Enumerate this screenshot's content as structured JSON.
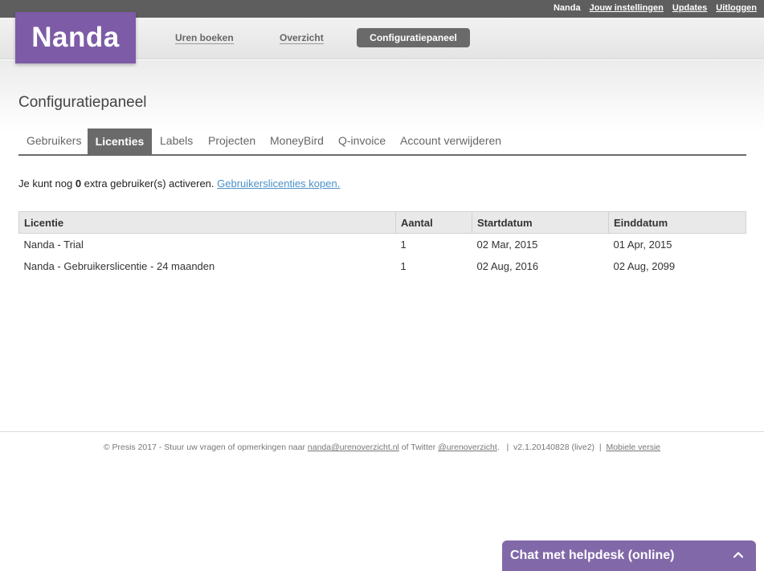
{
  "topbar": {
    "username": "Nanda",
    "settings_link": "Jouw instellingen",
    "updates_link": "Updates",
    "logout_link": "Uitloggen"
  },
  "header": {
    "logo": "Nanda",
    "nav": {
      "book_hours": "Uren boeken",
      "overview": "Overzicht",
      "config_panel": "Configuratiepaneel"
    }
  },
  "page": {
    "title": "Configuratiepaneel",
    "tabs": [
      "Gebruikers",
      "Licenties",
      "Labels",
      "Projecten",
      "MoneyBird",
      "Q-invoice",
      "Account verwijderen"
    ],
    "active_tab": "Licenties",
    "info": {
      "prefix": "Je kunt nog ",
      "count": "0",
      "suffix": " extra gebruiker(s) activeren. ",
      "buy_link": "Gebruikerslicenties kopen."
    }
  },
  "license_table": {
    "headers": [
      "Licentie",
      "Aantal",
      "Startdatum",
      "Einddatum"
    ],
    "rows": [
      [
        "Nanda - Trial",
        "1",
        "02 Mar, 2015",
        "01 Apr, 2015"
      ],
      [
        "Nanda - Gebruikerslicentie - 24 maanden",
        "1",
        "02 Aug, 2016",
        "02 Aug, 2099"
      ]
    ]
  },
  "footer": {
    "prefix": "© Presis 2017 - Stuur uw vragen of opmerkingen naar ",
    "email": "nanda@urenoverzicht.nl",
    "twitter_text": " of Twitter ",
    "twitter_handle": "@urenoverzicht",
    "version": ".   |  v2.1.20140828 (live2)  |  ",
    "mobile_link": "Mobiele versie"
  },
  "chat": {
    "label": "Chat met helpdesk (online)",
    "icon": "chevron-up-icon"
  },
  "colors": {
    "brand_purple": "#7d5ba6",
    "chat_purple": "#8169a9",
    "dark_gray": "#5e5e5e",
    "link_blue": "#4a90c8"
  }
}
